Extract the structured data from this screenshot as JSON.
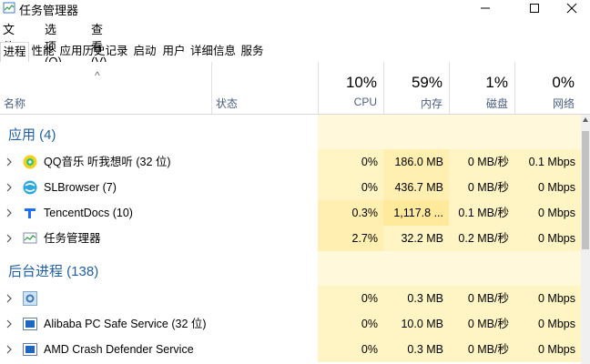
{
  "window": {
    "title": "任务管理器",
    "icon": "task-manager-icon"
  },
  "menu": [
    "文件(F)",
    "选项(O)",
    "查看(V)"
  ],
  "tabs": [
    "进程",
    "性能",
    "应用历史记录",
    "启动",
    "用户",
    "详细信息",
    "服务"
  ],
  "active_tab": "进程",
  "columns": {
    "name": "名称",
    "status": "状态",
    "cpu": {
      "pct": "10%",
      "label": "CPU"
    },
    "memory": {
      "pct": "59%",
      "label": "内存"
    },
    "disk": {
      "pct": "1%",
      "label": "磁盘"
    },
    "network": {
      "pct": "0%",
      "label": "网络"
    }
  },
  "groups": [
    {
      "title": "应用 (4)",
      "rows": [
        {
          "name": "QQ音乐 听我想听 (32 位)",
          "icon": "qq-music-icon",
          "cpu": "0%",
          "mem": "186.0 MB",
          "disk": "0 MB/秒",
          "net": "0.1 Mbps"
        },
        {
          "name": "SLBrowser (7)",
          "icon": "slbrowser-icon",
          "cpu": "0%",
          "mem": "436.7 MB",
          "disk": "0 MB/秒",
          "net": "0 Mbps"
        },
        {
          "name": "TencentDocs (10)",
          "icon": "tencent-docs-icon",
          "cpu": "0.3%",
          "mem": "1,117.8 ...",
          "disk": "0.1 MB/秒",
          "net": "0 Mbps"
        },
        {
          "name": "任务管理器",
          "icon": "task-manager-icon",
          "cpu": "2.7%",
          "mem": "32.2 MB",
          "disk": "0.2 MB/秒",
          "net": "0 Mbps"
        }
      ]
    },
    {
      "title": "后台进程 (138)",
      "rows": [
        {
          "name": "",
          "icon": "gear-service-icon",
          "cpu": "0%",
          "mem": "0.3 MB",
          "disk": "0 MB/秒",
          "net": "0 Mbps"
        },
        {
          "name": "Alibaba PC Safe Service (32 位)",
          "icon": "service-app-icon",
          "cpu": "0%",
          "mem": "10.0 MB",
          "disk": "0 MB/秒",
          "net": "0 Mbps"
        },
        {
          "name": "AMD Crash Defender Service",
          "icon": "service-app-icon",
          "cpu": "0%",
          "mem": "0.3 MB",
          "disk": "0 MB/秒",
          "net": "0 Mbps"
        }
      ]
    }
  ],
  "colors": {
    "heat_light": "#fff4c4",
    "heat_mid": "#ffefb0",
    "group_title": "#1f5fa8"
  }
}
